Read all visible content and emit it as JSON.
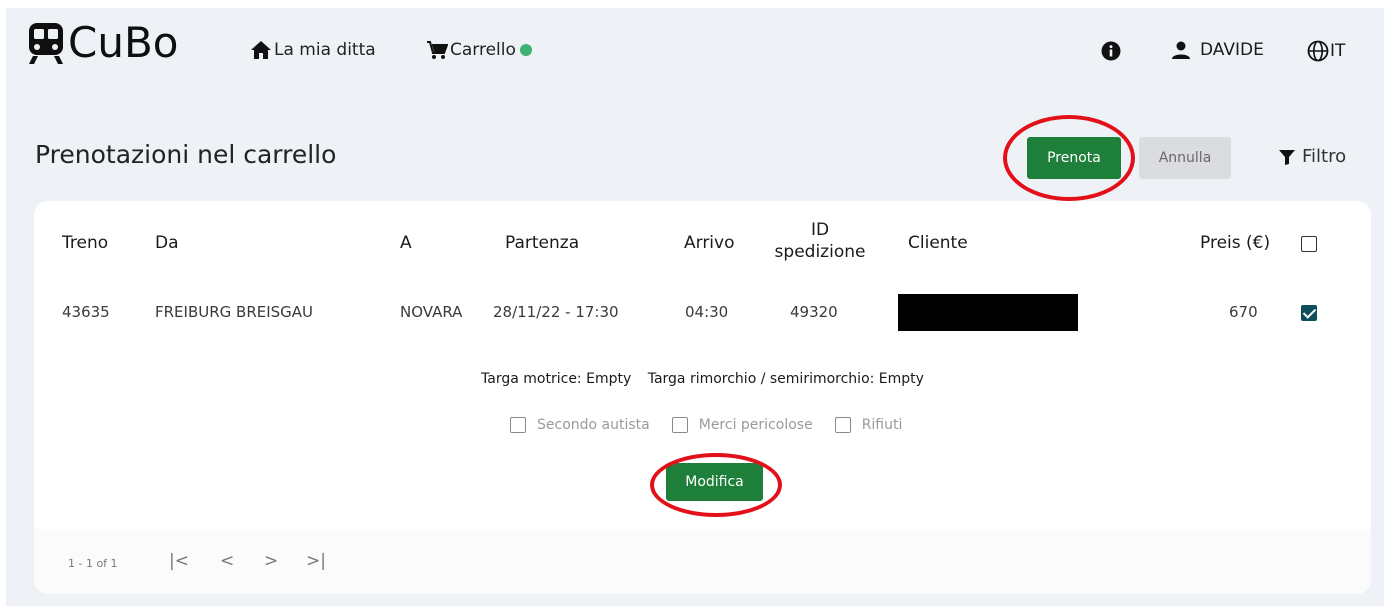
{
  "brand": {
    "name": "CuBo"
  },
  "nav": {
    "home_label": "La mia ditta",
    "cart_label": "Carrello",
    "user_label": "DAVIDE",
    "lang_label": "IT"
  },
  "page": {
    "title": "Prenotazioni nel carrello",
    "prenota_label": "Prenota",
    "annulla_label": "Annulla",
    "filter_label": "Filtro"
  },
  "table": {
    "headers": {
      "treno": "Treno",
      "da": "Da",
      "a": "A",
      "partenza": "Partenza",
      "arrivo": "Arrivo",
      "id_line1": "ID",
      "id_line2": "spedizione",
      "cliente": "Cliente",
      "preis": "Preis (€)"
    },
    "select_all_checked": false,
    "rows": [
      {
        "treno": "43635",
        "da": "FREIBURG BREISGAU",
        "a": "NOVARA",
        "partenza": "28/11/22 - 17:30",
        "arrivo": "04:30",
        "id_spedizione": "49320",
        "cliente": "",
        "preis": "670",
        "selected": true
      }
    ],
    "detail": {
      "targa_motrice": "Targa motrice: Empty",
      "targa_rimorchio": "Targa rimorchio / semirimorchio: Empty",
      "flags": [
        {
          "label": "Secondo autista",
          "checked": false
        },
        {
          "label": "Merci pericolose",
          "checked": false
        },
        {
          "label": "Rifiuti",
          "checked": false
        }
      ],
      "modifica_label": "Modifica"
    }
  },
  "pagination": {
    "range": "1 - 1 of 1",
    "first": "|<",
    "prev": "<",
    "next": ">",
    "last": ">|"
  },
  "colors": {
    "primary": "#1e7f3a",
    "cart_dot": "#3cb371",
    "annotation": "#e3101a",
    "checkbox_checked": "#0d4f5a",
    "background": "#eef2f7"
  }
}
